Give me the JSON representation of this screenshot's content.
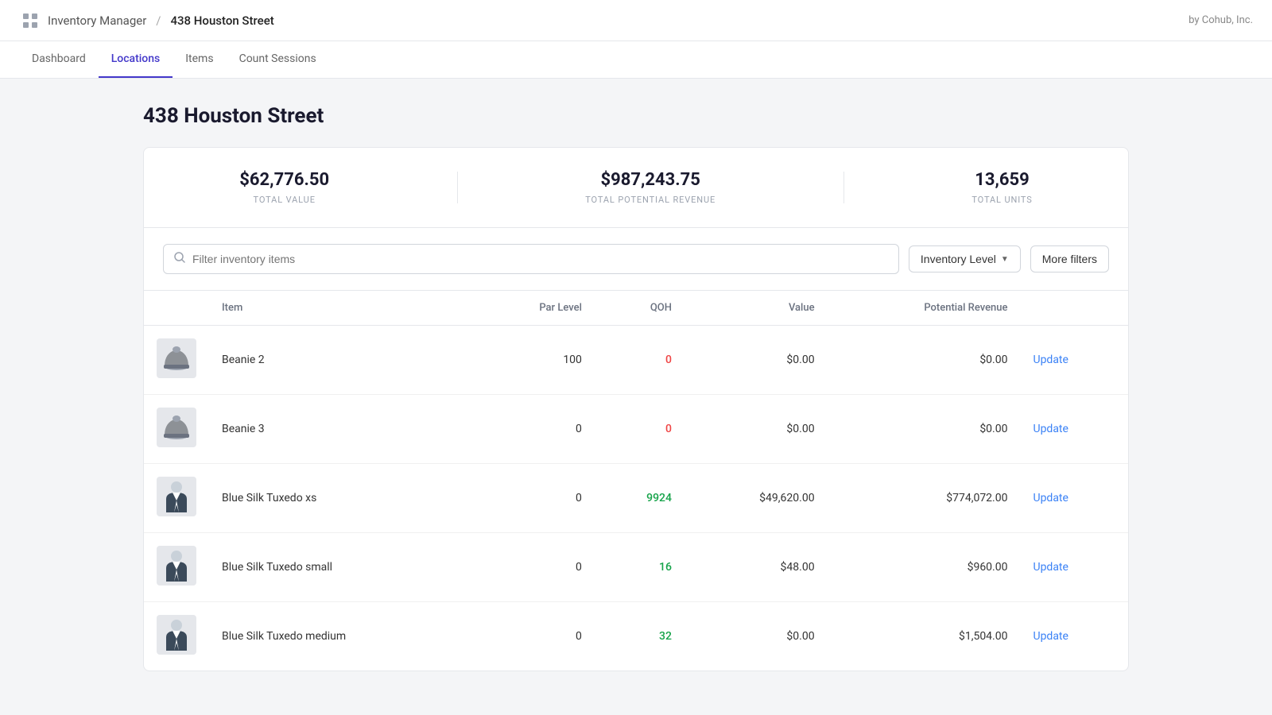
{
  "topbar": {
    "app_icon": "grid",
    "app_name": "Inventory Manager",
    "separator": "/",
    "location_name": "438 Houston Street",
    "brand": "by Cohub, Inc."
  },
  "nav": {
    "tabs": [
      {
        "id": "dashboard",
        "label": "Dashboard",
        "active": false
      },
      {
        "id": "locations",
        "label": "Locations",
        "active": true
      },
      {
        "id": "items",
        "label": "Items",
        "active": false
      },
      {
        "id": "count-sessions",
        "label": "Count Sessions",
        "active": false
      }
    ]
  },
  "page": {
    "title": "438 Houston Street"
  },
  "stats": {
    "total_value": "$62,776.50",
    "total_value_label": "TOTAL VALUE",
    "total_potential_revenue": "$987,243.75",
    "total_potential_revenue_label": "TOTAL POTENTIAL REVENUE",
    "total_units": "13,659",
    "total_units_label": "TOTAL UNITS"
  },
  "toolbar": {
    "search_placeholder": "Filter inventory items",
    "inventory_level_label": "Inventory Level",
    "more_filters_label": "More filters"
  },
  "table": {
    "columns": [
      {
        "id": "item",
        "label": "Item"
      },
      {
        "id": "par_level",
        "label": "Par Level"
      },
      {
        "id": "qoh",
        "label": "QOH"
      },
      {
        "id": "value",
        "label": "Value"
      },
      {
        "id": "potential_revenue",
        "label": "Potential Revenue"
      },
      {
        "id": "action",
        "label": ""
      }
    ],
    "rows": [
      {
        "id": 1,
        "name": "Beanie 2",
        "img_type": "beanie",
        "par_level": "100",
        "qoh": "0",
        "qoh_color": "red",
        "value": "$0.00",
        "potential_revenue": "$0.00",
        "action": "Update"
      },
      {
        "id": 2,
        "name": "Beanie 3",
        "img_type": "beanie",
        "par_level": "0",
        "qoh": "0",
        "qoh_color": "red",
        "value": "$0.00",
        "potential_revenue": "$0.00",
        "action": "Update"
      },
      {
        "id": 3,
        "name": "Blue Silk Tuxedo xs",
        "img_type": "tuxedo",
        "par_level": "0",
        "qoh": "9924",
        "qoh_color": "green",
        "value": "$49,620.00",
        "potential_revenue": "$774,072.00",
        "action": "Update"
      },
      {
        "id": 4,
        "name": "Blue Silk Tuxedo small",
        "img_type": "tuxedo",
        "par_level": "0",
        "qoh": "16",
        "qoh_color": "green",
        "value": "$48.00",
        "potential_revenue": "$960.00",
        "action": "Update"
      },
      {
        "id": 5,
        "name": "Blue Silk Tuxedo medium",
        "img_type": "tuxedo",
        "par_level": "0",
        "qoh": "32",
        "qoh_color": "green",
        "value": "$0.00",
        "potential_revenue": "$1,504.00",
        "action": "Update"
      }
    ]
  }
}
